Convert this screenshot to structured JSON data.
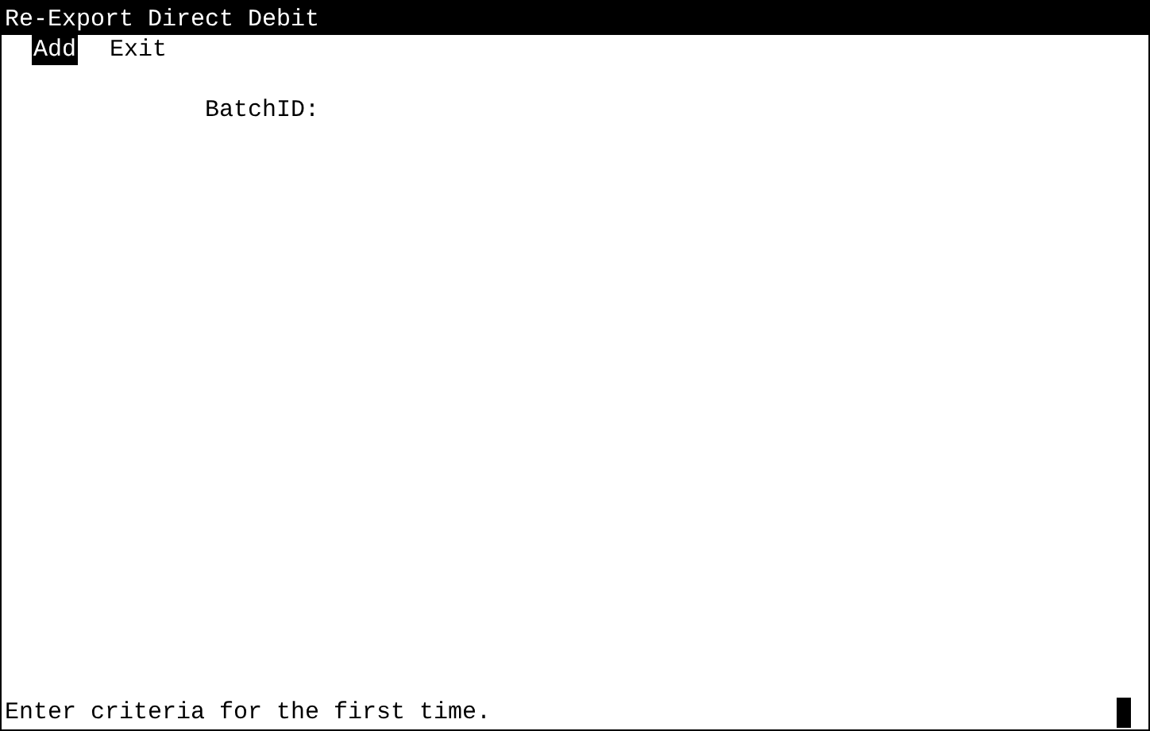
{
  "window": {
    "title": "Re-Export Direct Debit"
  },
  "menu": [
    {
      "label": "Add",
      "selected": true
    },
    {
      "label": "Exit",
      "selected": false
    }
  ],
  "fields": [
    {
      "label": "BatchID:"
    }
  ],
  "status_bar": "Enter criteria for the first time."
}
